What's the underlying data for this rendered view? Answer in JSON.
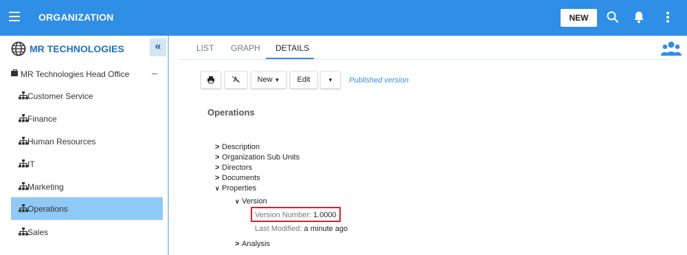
{
  "header": {
    "title": "ORGANIZATION",
    "new_label": "NEW",
    "bg_color": "#2f8ee5"
  },
  "sidebar": {
    "org_name": "MR TECHNOLOGIES",
    "collapse_label": "«",
    "root": {
      "label": "MR Technologies Head Office",
      "toggle": "–"
    },
    "units": [
      {
        "label": "Customer Service",
        "selected": false
      },
      {
        "label": "Finance",
        "selected": false
      },
      {
        "label": "Human Resources",
        "selected": false
      },
      {
        "label": "IT",
        "selected": false
      },
      {
        "label": "Marketing",
        "selected": false
      },
      {
        "label": "Operations",
        "selected": true
      },
      {
        "label": "Sales",
        "selected": false
      }
    ]
  },
  "tabs": [
    {
      "label": "LIST",
      "active": false
    },
    {
      "label": "GRAPH",
      "active": false
    },
    {
      "label": "DETAILS",
      "active": true
    }
  ],
  "toolbar": {
    "print_icon": "print-icon",
    "unpublish_icon": "unpublish-icon",
    "new_label": "New",
    "edit_label": "Edit",
    "status_label": "Published version"
  },
  "details": {
    "title": "Operations",
    "items": [
      {
        "label": "Description",
        "expanded": false
      },
      {
        "label": "Organization Sub Units",
        "expanded": false
      },
      {
        "label": "Directors",
        "expanded": false
      },
      {
        "label": "Documents",
        "expanded": false
      },
      {
        "label": "Properties",
        "expanded": true
      }
    ],
    "version_label": "Version",
    "version_number_label": "Version Number:",
    "version_number_value": "1.0000",
    "last_modified_label": "Last Modified:",
    "last_modified_value": "a minute ago",
    "analysis_label": "Analysis"
  }
}
